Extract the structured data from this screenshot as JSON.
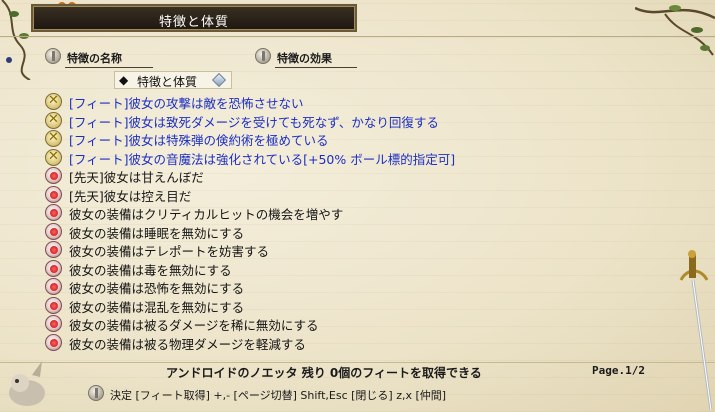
{
  "title": "特徴と体質",
  "headers": {
    "name": "特徴の名称",
    "effect": "特徴の効果"
  },
  "category": {
    "marker": "◆",
    "label": "特徴と体質"
  },
  "rows": [
    {
      "kind": "feat",
      "text": "[フィート]彼女の攻撃は敵を恐怖させない"
    },
    {
      "kind": "feat",
      "text": "[フィート]彼女は致死ダメージを受けても死なず、かなり回復する"
    },
    {
      "kind": "feat",
      "text": "[フィート]彼女は特殊弾の倹約術を極めている"
    },
    {
      "kind": "feat",
      "text": "[フィート]彼女の音魔法は強化されている[+50% ボール標的指定可]"
    },
    {
      "kind": "trait",
      "text": "[先天]彼女は甘えんぼだ"
    },
    {
      "kind": "trait",
      "text": "[先天]彼女は控え目だ"
    },
    {
      "kind": "trait",
      "text": "彼女の装備はクリティカルヒットの機会を増やす"
    },
    {
      "kind": "trait",
      "text": "彼女の装備は睡眠を無効にする"
    },
    {
      "kind": "trait",
      "text": "彼女の装備はテレポートを妨害する"
    },
    {
      "kind": "trait",
      "text": "彼女の装備は毒を無効にする"
    },
    {
      "kind": "trait",
      "text": "彼女の装備は恐怖を無効にする"
    },
    {
      "kind": "trait",
      "text": "彼女の装備は混乱を無効にする"
    },
    {
      "kind": "trait",
      "text": "彼女の装備は被るダメージを稀に無効にする"
    },
    {
      "kind": "trait",
      "text": "彼女の装備は被る物理ダメージを軽減する"
    }
  ],
  "status": "アンドロイドのノエッタ 残り 0個のフィートを取得できる",
  "page": "Page.1/2",
  "controls": "決定 [フィート取得]  +,- [ページ切替]  Shift,Esc [閉じる]  z,x [仲間]",
  "colors": {
    "feat_text": "#1c2fc4",
    "trait_text": "#141414",
    "title_bg": "#2a2219",
    "paper": "#ece3c8"
  }
}
